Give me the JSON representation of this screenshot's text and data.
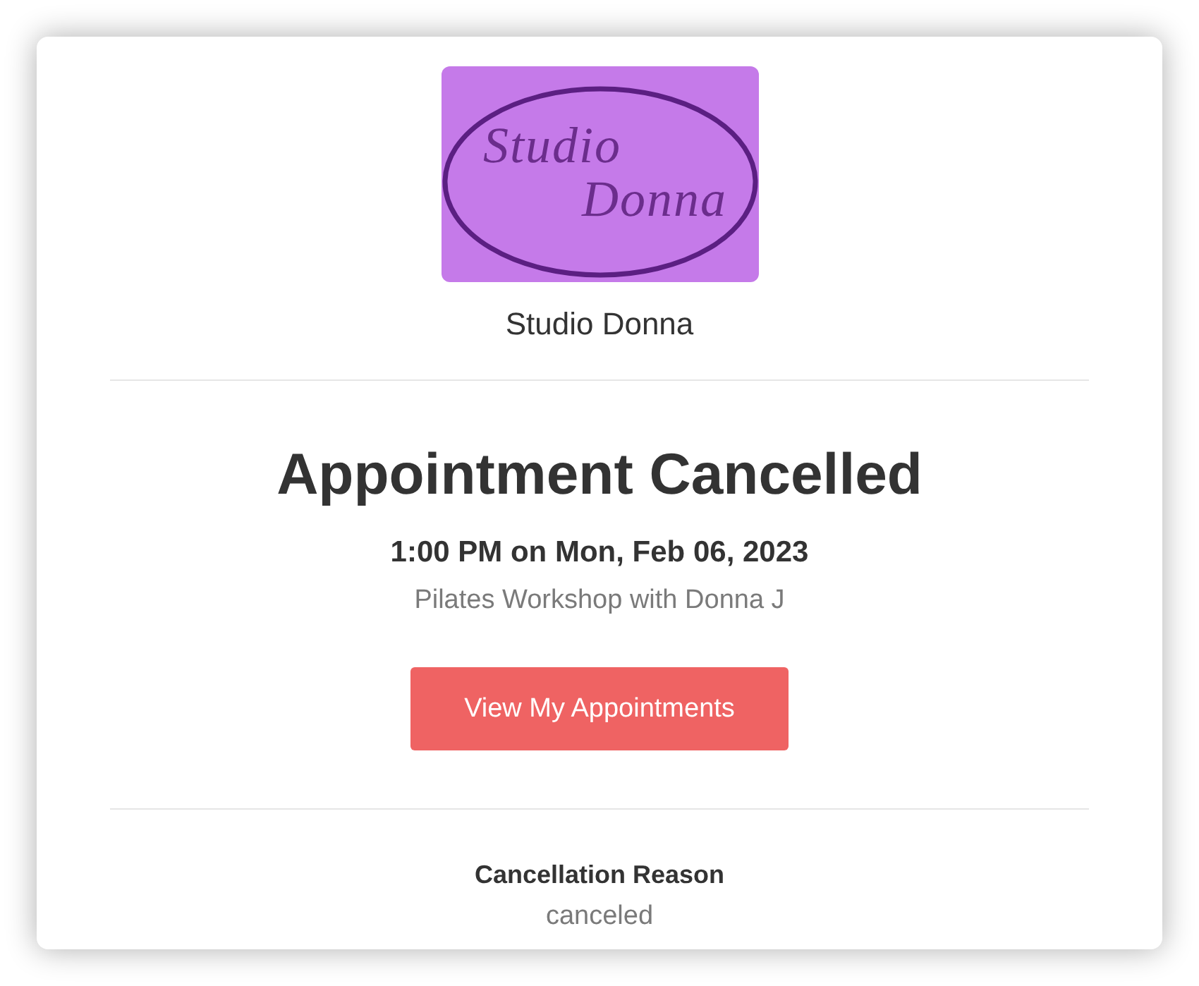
{
  "logo": {
    "lines": [
      "Studio",
      "Donna"
    ]
  },
  "business_name": "Studio Donna",
  "heading": "Appointment Cancelled",
  "appointment": {
    "time": "1:00 PM on Mon, Feb 06, 2023",
    "service": "Pilates Workshop with Donna J"
  },
  "button": {
    "label": "View My Appointments"
  },
  "cancellation": {
    "label": "Cancellation Reason",
    "value": "canceled"
  }
}
